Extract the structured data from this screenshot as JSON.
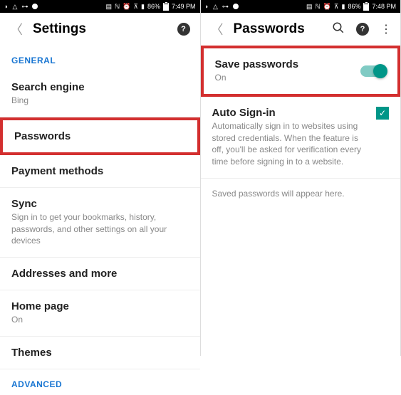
{
  "status_bar_left": {
    "battery_pct": "86%",
    "time1": "7:49 PM",
    "time2": "7:48 PM"
  },
  "left": {
    "title": "Settings",
    "section_general": "GENERAL",
    "items": [
      {
        "title": "Search engine",
        "sub": "Bing"
      },
      {
        "title": "Passwords"
      },
      {
        "title": "Payment methods"
      },
      {
        "title": "Sync",
        "sub": "Sign in to get your bookmarks, history, passwords, and other settings on all your devices"
      },
      {
        "title": "Addresses and more"
      },
      {
        "title": "Home page",
        "sub": "On"
      },
      {
        "title": "Themes"
      }
    ],
    "section_advanced": "ADVANCED"
  },
  "right": {
    "title": "Passwords",
    "save_passwords": {
      "title": "Save passwords",
      "sub": "On"
    },
    "auto_signin": {
      "title": "Auto Sign-in",
      "sub": "Automatically sign in to websites using stored credentials. When the feature is off, you'll be asked for verification every time before signing in to a website."
    },
    "info": "Saved passwords will appear here."
  }
}
